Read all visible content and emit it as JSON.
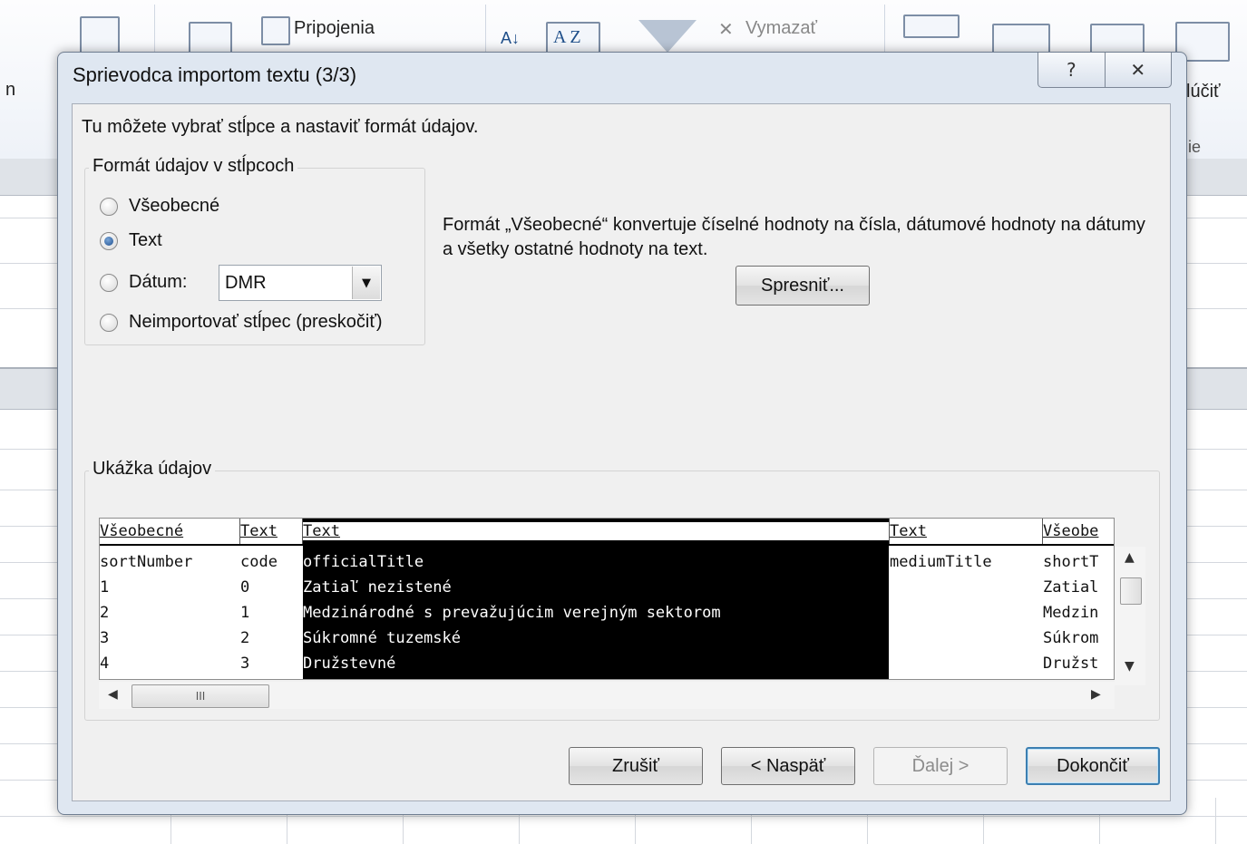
{
  "ribbon": {
    "connections_label": "Pripojenia",
    "clear_label": "Vymazať",
    "sort_az_label": "A Z",
    "right_edge_label": "lúčiť",
    "left_edge_label": "n",
    "partial_label": "ie"
  },
  "dialog": {
    "title": "Sprievodca importom textu (3/3)",
    "help_glyph": "?",
    "close_glyph": "✕",
    "intro": "Tu môžete vybrať stĺpce a nastaviť formát údajov.",
    "format_group": {
      "legend": "Formát údajov v stĺpcoch",
      "options": [
        {
          "label": "Všeobecné",
          "checked": false
        },
        {
          "label": "Text",
          "checked": true
        },
        {
          "label": "Dátum:",
          "checked": false
        },
        {
          "label": "Neimportovať stĺpec (preskočiť)",
          "checked": false
        }
      ],
      "date_combo_value": "DMR",
      "combo_arrow": "▼"
    },
    "description": "Formát „Všeobecné“ konvertuje číselné hodnoty na čísla, dátumové hodnoty na dátumy a všetky ostatné hodnoty na text.",
    "advanced_button": "Spresniť...",
    "preview_group": {
      "legend": "Ukážka údajov",
      "columns": [
        {
          "header": "Všeobecné",
          "rows": [
            "sortNumber",
            "1",
            "2",
            "3",
            "4"
          ],
          "selected": false
        },
        {
          "header": "Text",
          "rows": [
            "code",
            "0",
            "1",
            "2",
            "3"
          ],
          "selected": false
        },
        {
          "header": "Text",
          "rows": [
            "officialTitle",
            "Zatiaľ nezistené",
            "Medzinárodné s prevažujúcim verejným sektorom",
            "Súkromné tuzemské",
            "Družstevné"
          ],
          "selected": true
        },
        {
          "header": "Text",
          "rows": [
            "mediumTitle",
            "",
            "",
            "",
            ""
          ],
          "selected": false
        },
        {
          "header": "Všeobe",
          "rows": [
            "shortT",
            "Zatial",
            "Medzin",
            "Súkrom",
            "Družst"
          ],
          "selected": false
        }
      ],
      "hscroll_thumb_glyph": "III"
    },
    "buttons": {
      "cancel": "Zrušiť",
      "back": "< Naspäť",
      "next": "Ďalej >",
      "finish": "Dokončiť"
    }
  }
}
